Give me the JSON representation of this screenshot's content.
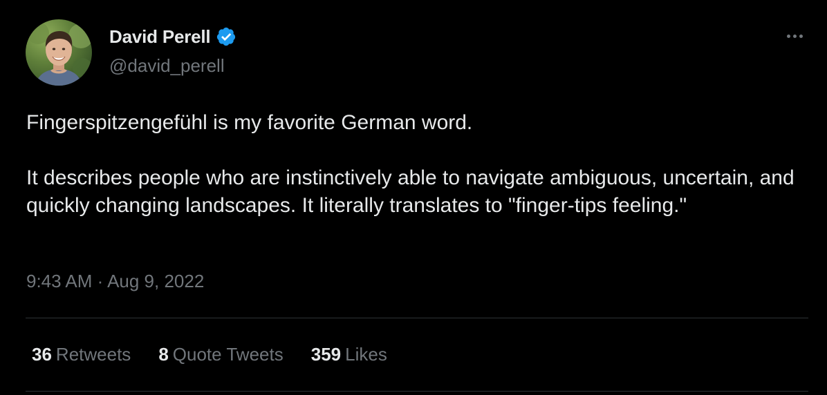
{
  "author": {
    "name": "David Perell",
    "handle": "@david_perell",
    "verified": true,
    "verified_color": "#1d9bf0"
  },
  "tweet": {
    "paragraphs": [
      "Fingerspitzengefühl is my favorite German word.",
      "It describes people who are instinctively able to navigate ambiguous, uncertain, and quickly changing landscapes. It literally translates to \"finger-tips feeling.\""
    ],
    "timestamp": "9:43 AM · Aug 9, 2022"
  },
  "stats": {
    "retweets": {
      "count": "36",
      "label": "Retweets"
    },
    "quote_tweets": {
      "count": "8",
      "label": "Quote Tweets"
    },
    "likes": {
      "count": "359",
      "label": "Likes"
    }
  },
  "icons": {
    "more": "more-horizontal-icon",
    "verified": "verified-badge-icon"
  },
  "colors": {
    "background": "#000000",
    "text": "#e7e9ea",
    "secondary_text": "#71767b",
    "divider": "#2f3336"
  }
}
